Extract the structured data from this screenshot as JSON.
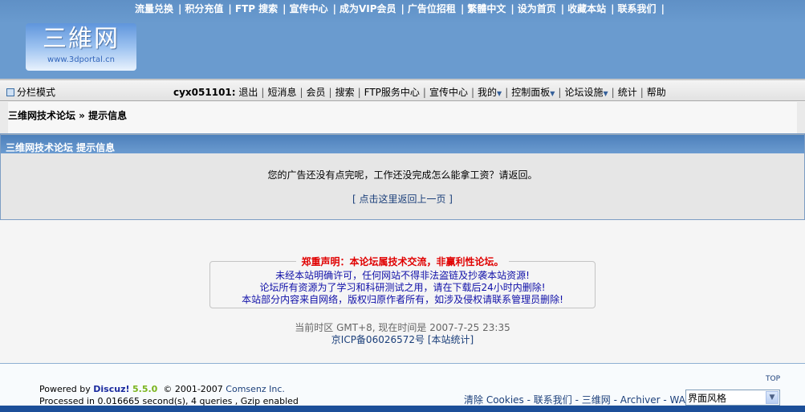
{
  "top_links": [
    "流量兑换",
    "积分充值",
    "FTP 搜索",
    "宣传中心",
    "成为VIP会员",
    "广告位招租",
    "繁體中文",
    "设为首页",
    "收藏本站",
    "联系我们"
  ],
  "logo": {
    "title": "三維网",
    "url": "www.3dportal.cn"
  },
  "navbar": {
    "column_mode": "分栏模式",
    "username": "cyx051101:",
    "items": [
      {
        "label": "退出"
      },
      {
        "label": "短消息"
      },
      {
        "label": "会员"
      },
      {
        "label": "搜索"
      },
      {
        "label": "FTP服务中心"
      },
      {
        "label": "宣传中心"
      },
      {
        "label": "我的",
        "dropdown": true
      },
      {
        "label": "控制面板",
        "dropdown": true
      },
      {
        "label": "论坛设施",
        "dropdown": true
      },
      {
        "label": "统计"
      },
      {
        "label": "帮助"
      }
    ]
  },
  "breadcrumb": "三维网技术论坛 » 提示信息",
  "message": {
    "header": "三维网技术论坛 提示信息",
    "text": "您的广告还没有点完呢，工作还没完成怎么能拿工资？请返回。",
    "back_link": "[ 点击这里返回上一页 ]"
  },
  "notice": {
    "title": "郑重声明：本论坛属技术交流，非赢利性论坛。",
    "lines": [
      "未经本站明确许可，任何网站不得非法盗链及抄袭本站资源!",
      "论坛所有资源为了学习和科研测试之用，请在下载后24小时内删除!",
      "本站部分内容来自网络，版权归原作者所有，如涉及侵权请联系管理员删除!"
    ]
  },
  "time_info": "当前时区 GMT+8, 现在时间是 2007-7-25 23:35",
  "icp": "京ICP备06026572号",
  "stats_link": "[本站统计]",
  "footer": {
    "powered_by": "Powered by",
    "discuz": "Discuz!",
    "version": "5.5.0",
    "copyright": "© 2001-2007",
    "company": "Comsenz Inc.",
    "processed": "Processed in 0.016665 second(s), 4 queries , Gzip enabled",
    "top": "TOP",
    "links": [
      "清除 Cookies",
      "联系我们",
      "三维网",
      "Archiver",
      "WAP"
    ],
    "style_select": "界面风格"
  }
}
